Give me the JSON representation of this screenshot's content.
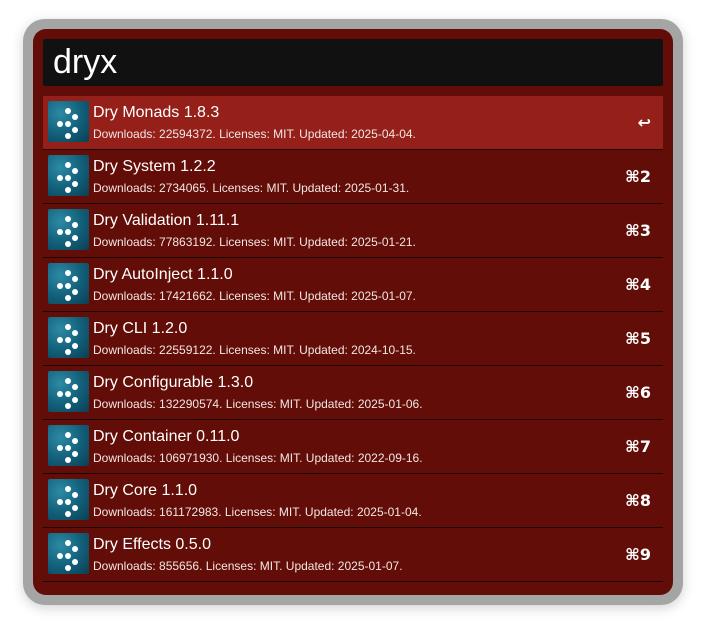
{
  "search": {
    "query": "dryx"
  },
  "results": [
    {
      "title": "Dry Monads 1.8.3",
      "subtitle": "Downloads: 22594372. Licenses: MIT. Updated: 2025-04-04.",
      "shortcut": "↩",
      "selected": true,
      "icon": "dry-rb-logo-icon"
    },
    {
      "title": "Dry System 1.2.2",
      "subtitle": "Downloads: 2734065. Licenses: MIT. Updated: 2025-01-31.",
      "shortcut": "⌘2",
      "selected": false,
      "icon": "dry-rb-logo-icon"
    },
    {
      "title": "Dry Validation 1.11.1",
      "subtitle": "Downloads: 77863192. Licenses: MIT. Updated: 2025-01-21.",
      "shortcut": "⌘3",
      "selected": false,
      "icon": "dry-rb-logo-icon"
    },
    {
      "title": "Dry AutoInject 1.1.0",
      "subtitle": "Downloads: 17421662. Licenses: MIT. Updated: 2025-01-07.",
      "shortcut": "⌘4",
      "selected": false,
      "icon": "dry-rb-logo-icon"
    },
    {
      "title": "Dry CLI 1.2.0",
      "subtitle": "Downloads: 22559122. Licenses: MIT. Updated: 2024-10-15.",
      "shortcut": "⌘5",
      "selected": false,
      "icon": "dry-rb-logo-icon"
    },
    {
      "title": "Dry Configurable 1.3.0",
      "subtitle": "Downloads: 132290574. Licenses: MIT. Updated: 2025-01-06.",
      "shortcut": "⌘6",
      "selected": false,
      "icon": "dry-rb-logo-icon"
    },
    {
      "title": "Dry Container 0.11.0",
      "subtitle": "Downloads: 106971930. Licenses: MIT. Updated: 2022-09-16.",
      "shortcut": "⌘7",
      "selected": false,
      "icon": "dry-rb-logo-icon"
    },
    {
      "title": "Dry Core 1.1.0",
      "subtitle": "Downloads: 161172983. Licenses: MIT. Updated: 2025-01-04.",
      "shortcut": "⌘8",
      "selected": false,
      "icon": "dry-rb-logo-icon"
    },
    {
      "title": "Dry Effects 0.5.0",
      "subtitle": "Downloads: 855656. Licenses: MIT. Updated: 2025-01-07.",
      "shortcut": "⌘9",
      "selected": false,
      "icon": "dry-rb-logo-icon"
    }
  ],
  "colors": {
    "frame": "#a5a5a5",
    "panel": "#620d07",
    "selected_row": "#95201a",
    "search_bg": "#111111"
  }
}
